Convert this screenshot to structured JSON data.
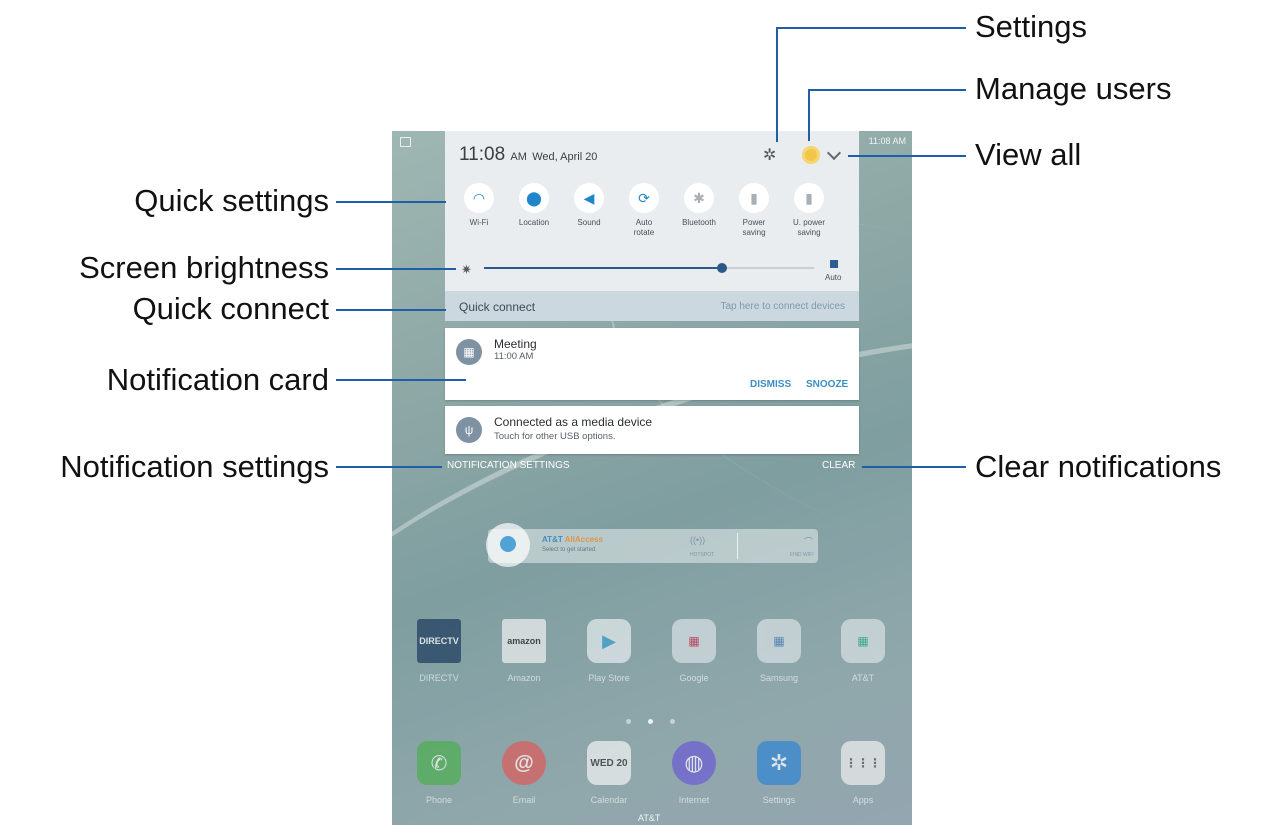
{
  "callouts": {
    "settings": "Settings",
    "manage_users": "Manage users",
    "view_all": "View all",
    "quick_settings": "Quick settings",
    "screen_brightness": "Screen brightness",
    "quick_connect": "Quick connect",
    "notification_card": "Notification card",
    "notification_settings": "Notification settings",
    "clear_notifications": "Clear notifications"
  },
  "status_bar": {
    "time": "11:08 AM",
    "calendar_icon": "calendar-icon"
  },
  "panel": {
    "time": "11:08",
    "ampm": "AM",
    "date": "Wed, April 20",
    "icons": {
      "settings": "gear-icon",
      "user": "user-avatar-icon",
      "expand": "chevron-down-icon"
    },
    "quick_settings": [
      {
        "label": "Wi-Fi",
        "icon": "wifi-icon",
        "active": true
      },
      {
        "label": "Location",
        "icon": "location-pin-icon",
        "active": true
      },
      {
        "label": "Sound",
        "icon": "speaker-icon",
        "active": true
      },
      {
        "label": "Auto rotate",
        "icon": "rotate-icon",
        "active": true
      },
      {
        "label": "Bluetooth",
        "icon": "bluetooth-icon",
        "active": false
      },
      {
        "label": "Power saving",
        "icon": "battery-icon",
        "active": false
      },
      {
        "label": "U. power saving",
        "icon": "ultra-battery-icon",
        "active": false
      }
    ],
    "brightness": {
      "level": 0.72,
      "auto_label": "Auto",
      "auto_checked": true
    },
    "quick_connect": {
      "label": "Quick connect",
      "hint": "Tap here to connect devices"
    }
  },
  "notifications": [
    {
      "title": "Meeting",
      "subtitle": "11:00 AM",
      "icon": "calendar-icon",
      "actions": [
        "DISMISS",
        "SNOOZE"
      ]
    },
    {
      "title": "Connected as a media device",
      "subtitle": "Touch for other USB options.",
      "icon": "usb-icon"
    }
  ],
  "notification_settings_label": "NOTIFICATION SETTINGS",
  "clear_label": "CLEAR",
  "widget": {
    "brand": "AT&T ",
    "brand_accent": "AllAccess",
    "subtitle": "Select to get started",
    "hotspot": "HOTSPOT",
    "wifi": "FIND WIFI"
  },
  "apps_row": [
    {
      "name": "DIRECTV",
      "badge": "DIRECTV",
      "color": "#1c3a5e"
    },
    {
      "name": "Amazon",
      "badge": "amazon",
      "color": "#f2f2f2"
    },
    {
      "name": "Play Store",
      "badge": "",
      "color": "#e8eef0"
    },
    {
      "name": "Google",
      "badge": "",
      "color": "#d9e2e6"
    },
    {
      "name": "Samsung",
      "badge": "",
      "color": "#d9e2e6"
    },
    {
      "name": "AT&T",
      "badge": "",
      "color": "#d9e2e6"
    }
  ],
  "dock": [
    {
      "name": "Phone",
      "badge": "✆",
      "color": "#4caf50"
    },
    {
      "name": "Email",
      "badge": "@",
      "color": "#e05a5a"
    },
    {
      "name": "Calendar",
      "badge": "WED 20",
      "color": "#f4f4f4"
    },
    {
      "name": "Internet",
      "badge": "◍",
      "color": "#6b5bd6"
    },
    {
      "name": "Settings",
      "badge": "✲",
      "color": "#2f84d4"
    },
    {
      "name": "Apps",
      "badge": "⋮⋮⋮",
      "color": "#f0f0f0"
    }
  ],
  "carrier": "AT&T"
}
